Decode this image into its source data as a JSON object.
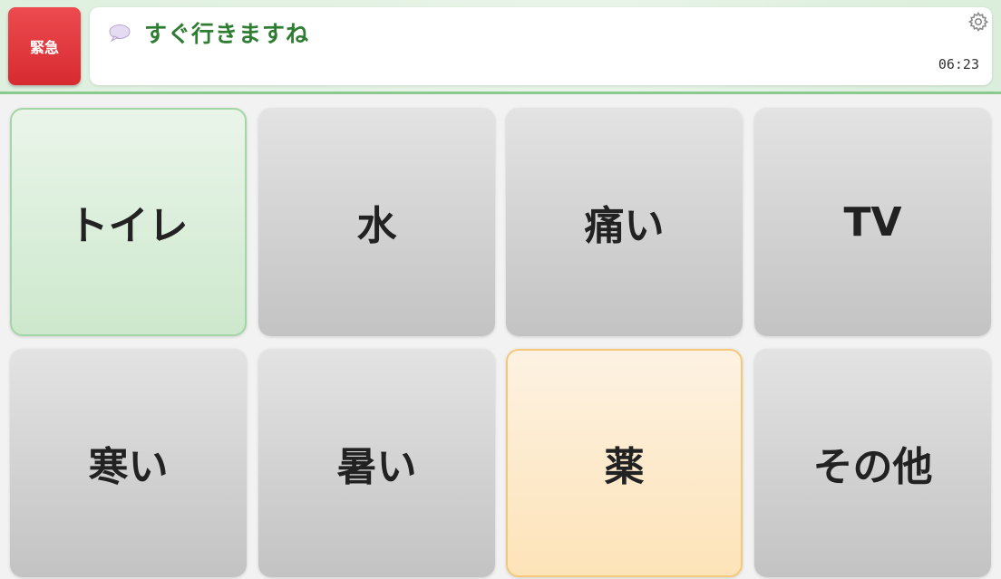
{
  "header": {
    "emergency_label": "緊急",
    "message_text": "すぐ行きますね",
    "time": "06:23"
  },
  "tiles": [
    {
      "label": "トイレ",
      "style": "green"
    },
    {
      "label": "水",
      "style": "gray"
    },
    {
      "label": "痛い",
      "style": "gray"
    },
    {
      "label": "TV",
      "style": "gray"
    },
    {
      "label": "寒い",
      "style": "gray"
    },
    {
      "label": "暑い",
      "style": "gray"
    },
    {
      "label": "薬",
      "style": "orange"
    },
    {
      "label": "その他",
      "style": "gray"
    }
  ],
  "colors": {
    "emergency": "#d72a31",
    "message_text": "#2e7d32",
    "header_border": "#8cc98f",
    "tile_green_border": "#a4d5a6",
    "tile_orange_border": "#f6c97a"
  },
  "icons": {
    "message": "speech-bubble-icon",
    "settings": "gear-icon"
  }
}
